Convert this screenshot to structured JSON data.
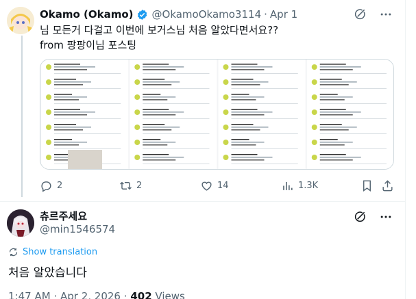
{
  "tweet": {
    "author_name": "Okamo (Okamo)",
    "handle": "@OkamoOkamo3114",
    "separator": "·",
    "date": "Apr 1",
    "text_line1": "님 모든거 다걸고 이번에 보거스님 처음 알았다면서요??",
    "text_line2": "from 팡팡이님 포스팅",
    "media_alt": "Screenshots of replies",
    "actions": {
      "replies": "2",
      "reposts": "2",
      "likes": "14",
      "views": "1.3K"
    }
  },
  "reply": {
    "author_name": "츄르주세요",
    "handle": "@min1546574",
    "show_translation": "Show translation",
    "text": "처음 알았습니다",
    "time": "1:47 AM",
    "date": "Apr 2, 2026",
    "views_count": "402",
    "views_label": "Views"
  },
  "colors": {
    "text": "#0f1419",
    "secondary": "#536471",
    "link": "#1d9bf0",
    "border": "#cfd9de",
    "verified": "#1d9bf0"
  }
}
